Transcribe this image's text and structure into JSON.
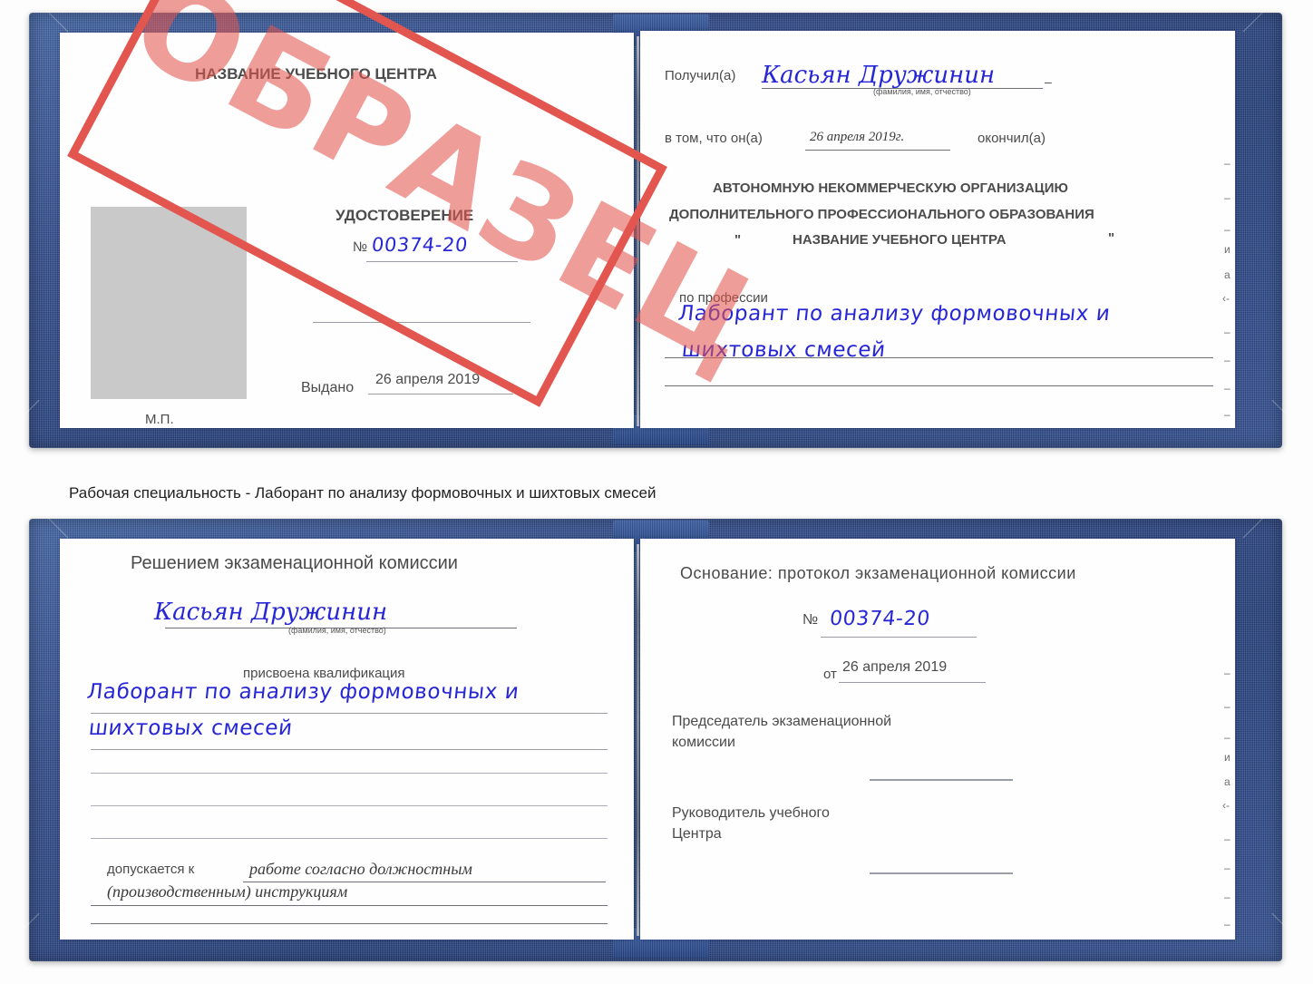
{
  "caption": "Рабочая специальность - Лаборант по анализу формовочных и шихтовых смесей",
  "stamp": {
    "text": "ОБРАЗЕЦ",
    "color": "#e2564f"
  },
  "colors": {
    "cover_blue": "#2b4687",
    "handwriting_blue": "#2626d6",
    "stamp_red": "#e2564f",
    "photo_gray": "#c9c9c9",
    "rule_gray": "#9a9da3"
  },
  "certificate_top": {
    "left_page": {
      "org_title": "НАЗВАНИЕ УЧЕБНОГО ЦЕНТРА",
      "doc_type": "УДОСТОВЕРЕНИЕ",
      "number_label": "№",
      "number_value": "00374-20",
      "issued_label": "Выдано",
      "issued_value": "26 апреля 2019",
      "seal_label": "М.П."
    },
    "right_page": {
      "received_label": "Получил(а)",
      "received_value": "Касьян Дружинин",
      "fio_hint": "(фамилия, имя, отчество)",
      "that_he_label": "в том, что он(а)",
      "that_he_value": "26 апреля 2019г.",
      "finished_label": "окончил(а)",
      "org_line1": "АВТОНОМНУЮ НЕКОММЕРЧЕСКУЮ ОРГАНИЗАЦИЮ",
      "org_line2": "ДОПОЛНИТЕЛЬНОГО ПРОФЕССИОНАЛЬНОГО ОБРАЗОВАНИЯ",
      "quote_open": "\"",
      "org_line3": "НАЗВАНИЕ УЧЕБНОГО ЦЕНТРА",
      "quote_close": "\"",
      "profession_label": "по профессии",
      "profession_line1": "Лаборант по анализу формовочных и",
      "profession_line2": "шихтовых смесей"
    },
    "margin_marks": [
      "–",
      "–",
      "и",
      "а",
      "‹-",
      "–",
      "–",
      "–"
    ]
  },
  "certificate_bottom": {
    "left_page": {
      "commission_title": "Решением экзаменационной комиссии",
      "name_value": "Касьян Дружинин",
      "fio_hint": "(фамилия, имя, отчество)",
      "qualification_label": "присвоена квалификация",
      "qualification_line1": "Лаборант по анализу формовочных и",
      "qualification_line2": "шихтовых смесей",
      "admitted_label": "допускается к",
      "admitted_value_line1": "работе согласно должностным",
      "admitted_value_line2": "(производственным) инструкциям"
    },
    "right_page": {
      "basis_label": "Основание: протокол экзаменационной комиссии",
      "number_label": "№",
      "number_value": "00374-20",
      "date_label": "от",
      "date_value": "26 апреля 2019",
      "chairman_line1": "Председатель экзаменационной",
      "chairman_line2": "комиссии",
      "head_line1": "Руководитель учебного",
      "head_line2": "Центра"
    },
    "margin_marks": [
      "–",
      "–",
      "и",
      "а",
      "‹-",
      "–",
      "–",
      "–"
    ]
  }
}
